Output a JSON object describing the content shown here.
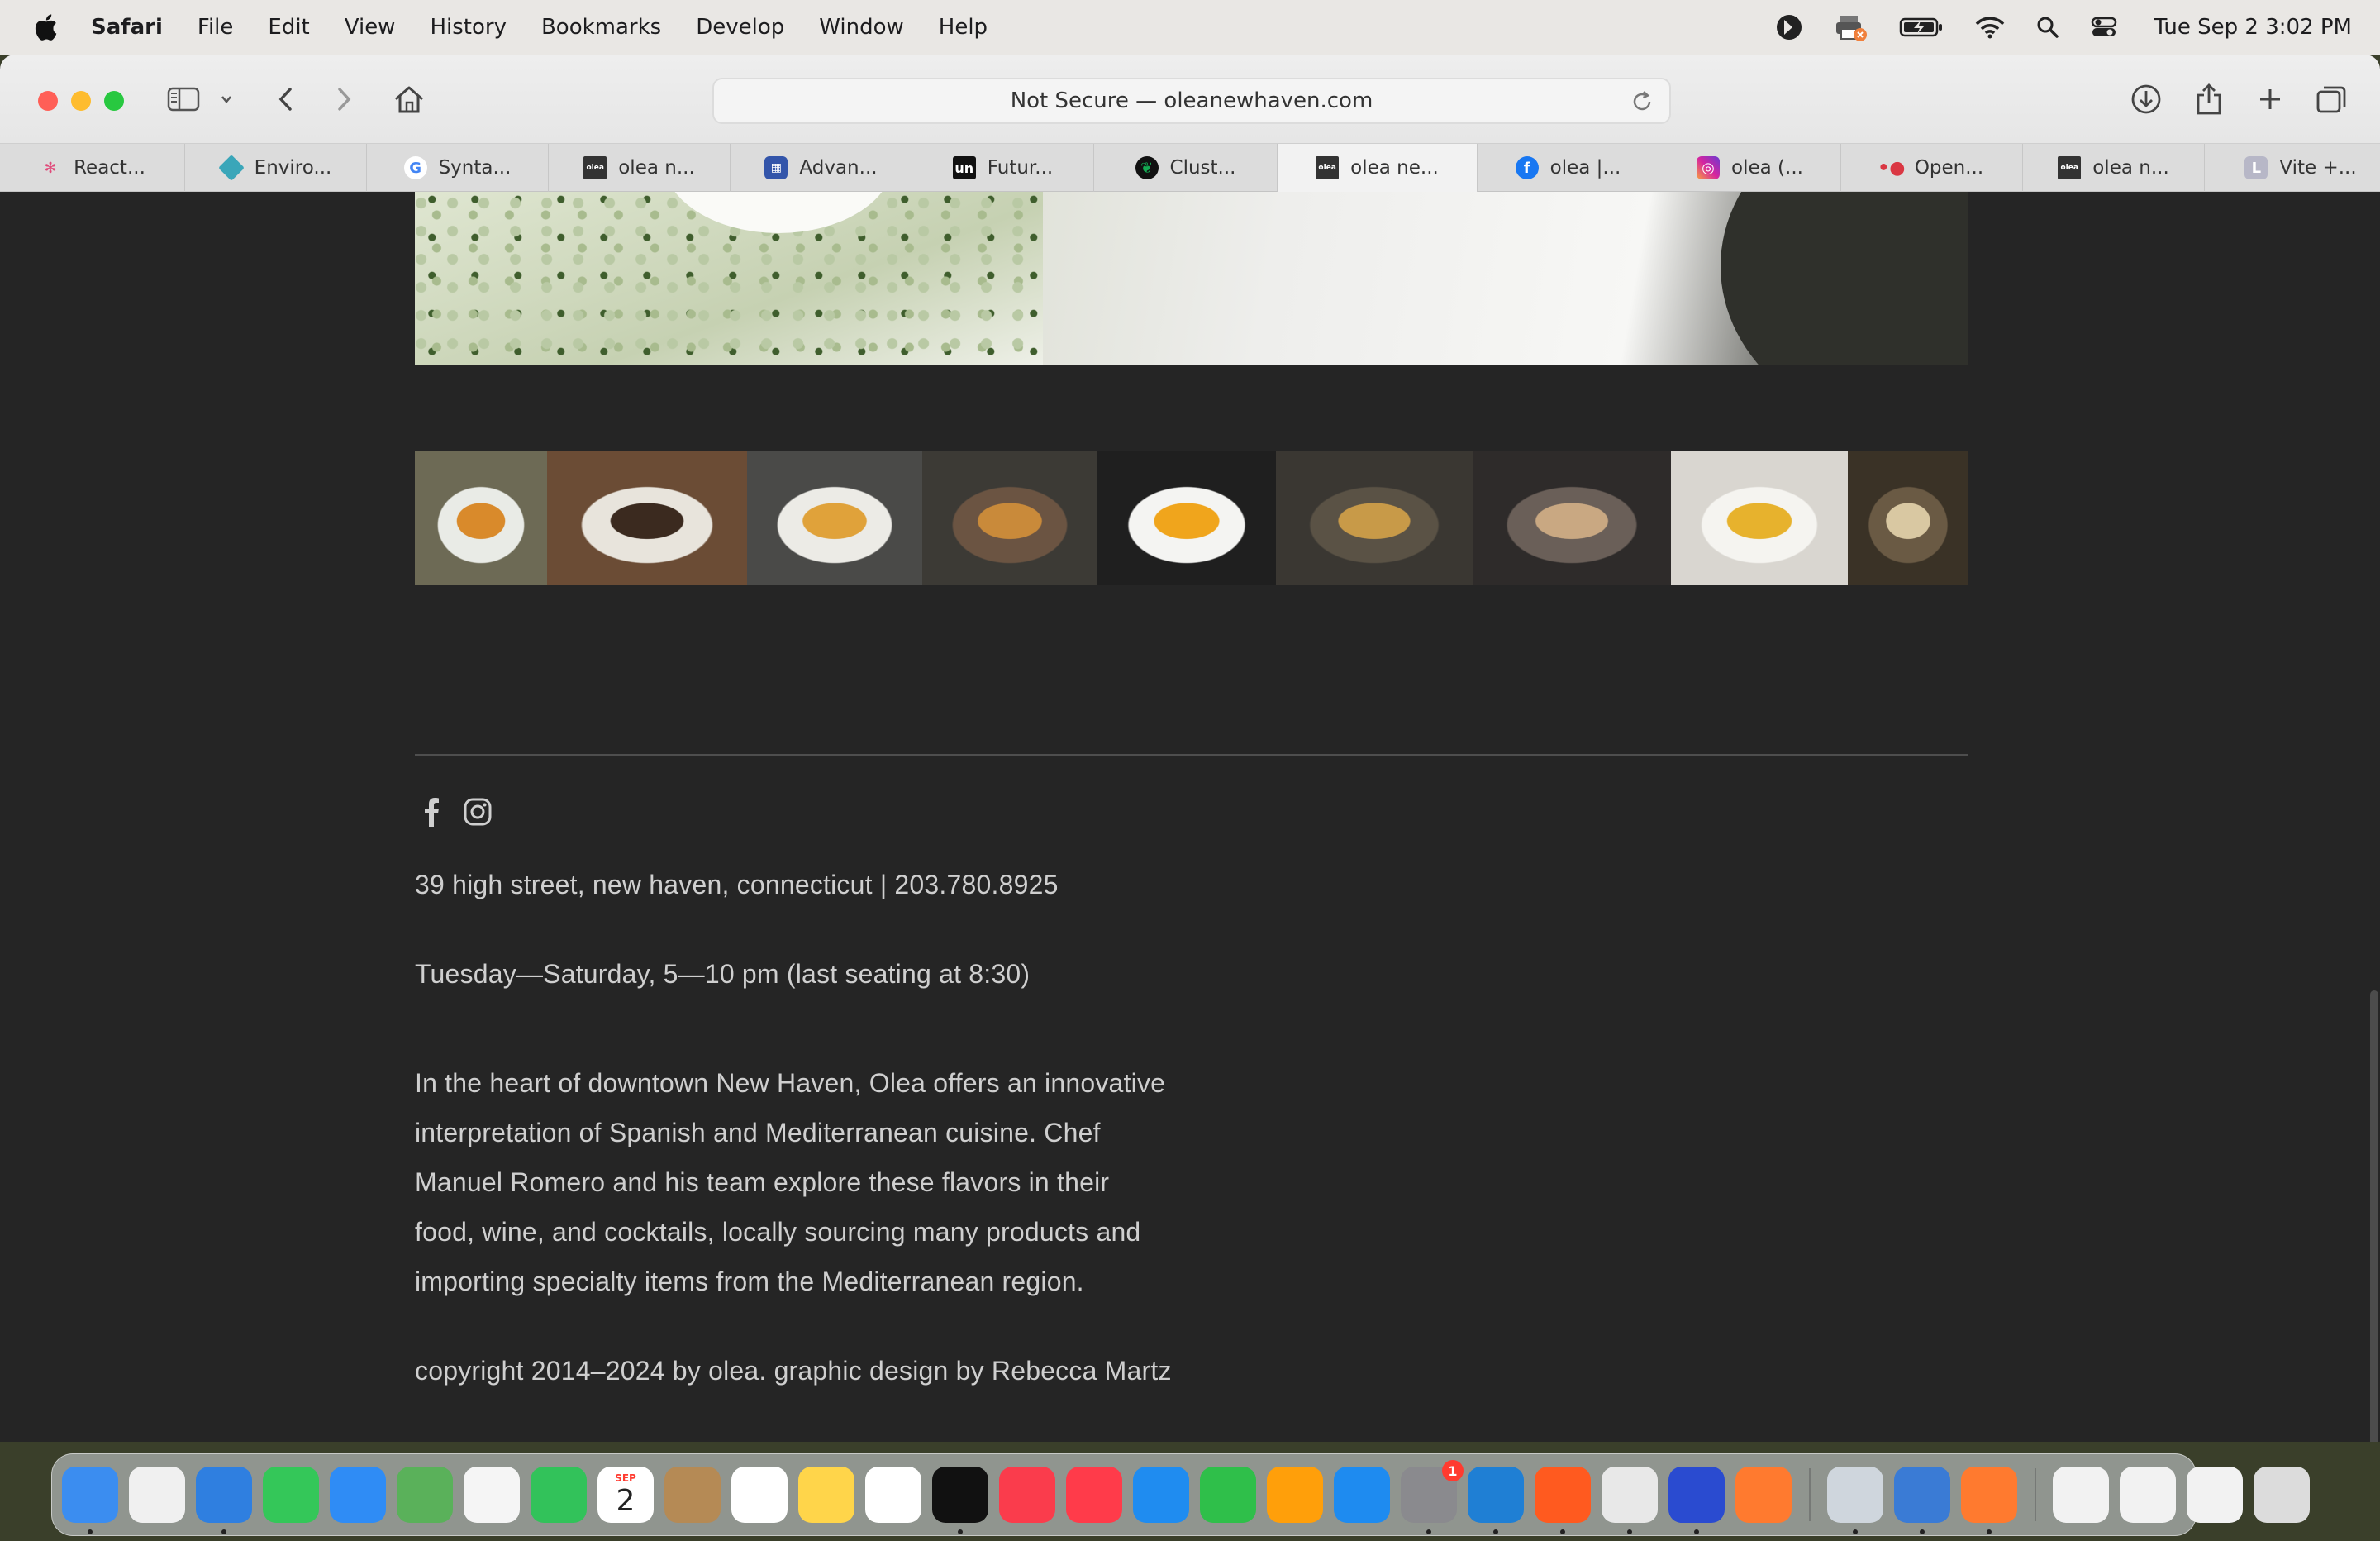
{
  "menubar": {
    "app_name": "Safari",
    "items": [
      "File",
      "Edit",
      "View",
      "History",
      "Bookmarks",
      "Develop",
      "Window",
      "Help"
    ],
    "clock": "Tue Sep 2  3:02 PM"
  },
  "browser": {
    "url_text": "Not Secure — oleanewhaven.com",
    "tabs": [
      {
        "label": "React...",
        "icon": "react-icon",
        "color": "#e04a7a"
      },
      {
        "label": "Enviro...",
        "icon": "diamond-icon",
        "color": "#3aa6b9"
      },
      {
        "label": "Synta...",
        "icon": "google-icon",
        "color": "#4285f4"
      },
      {
        "label": "olea n...",
        "icon": "olea-icon",
        "color": "#333333"
      },
      {
        "label": "Advan...",
        "icon": "bank-icon",
        "color": "#3355aa"
      },
      {
        "label": "Futur...",
        "icon": "unsplash-icon",
        "color": "#111111"
      },
      {
        "label": "Clust...",
        "icon": "mongodb-leaf-icon",
        "color": "#13aa52"
      },
      {
        "label": "olea ne...",
        "icon": "olea-icon",
        "color": "#333333",
        "active": true
      },
      {
        "label": "olea |...",
        "icon": "facebook-icon",
        "color": "#1877f2"
      },
      {
        "label": "olea (...",
        "icon": "instagram-icon",
        "color": "#d6249f"
      },
      {
        "label": "Open...",
        "icon": "opentable-icon",
        "color": "#da3743"
      },
      {
        "label": "olea n...",
        "icon": "olea-icon",
        "color": "#333333"
      },
      {
        "label": "Vite +...",
        "icon": "letter-l-icon",
        "color": "#b7b7c7"
      }
    ]
  },
  "footer": {
    "address": "39 high street, new haven, connecticut  |  203.780.8925",
    "hours": "Tuesday—Saturday, 5—10 pm (last seating at 8:30)",
    "about": "In the heart of downtown New Haven, Olea offers an innovative interpretation of Spanish and Mediterranean cuisine. Chef Manuel Romero and his team explore these flavors in their food, wine, and cocktails, locally sourcing many products and importing specialty items from the Mediterranean region.",
    "copyright": "copyright 2014–2024  by olea. graphic design by Rebecca Martz"
  },
  "gallery": {
    "thumbnails": [
      {
        "name": "dish-thumbnail-1",
        "colors": [
          "#6d6a55",
          "#e9ebe6",
          "#d98a2b"
        ]
      },
      {
        "name": "dish-thumbnail-2",
        "colors": [
          "#6b4c35",
          "#e8e4dc",
          "#3b2a1f"
        ]
      },
      {
        "name": "dish-thumbnail-3",
        "colors": [
          "#4a4a48",
          "#ecebe6",
          "#e0a23a"
        ]
      },
      {
        "name": "dish-thumbnail-4",
        "colors": [
          "#3c3a35",
          "#6b5442",
          "#c98a3a"
        ]
      },
      {
        "name": "dish-thumbnail-5",
        "colors": [
          "#1f1f1f",
          "#f4f4f2",
          "#f0a51c"
        ]
      },
      {
        "name": "dish-thumbnail-6",
        "colors": [
          "#3a3732",
          "#5a5245",
          "#c89a48"
        ]
      },
      {
        "name": "dish-thumbnail-7",
        "colors": [
          "#2e2b2a",
          "#6a5f58",
          "#c9a882"
        ]
      },
      {
        "name": "dish-thumbnail-8",
        "colors": [
          "#d9d6d0",
          "#f5f4f0",
          "#e7b22d"
        ]
      },
      {
        "name": "dining-room-thumbnail",
        "colors": [
          "#3a3226",
          "#6a5a44",
          "#d9c8a2"
        ]
      }
    ]
  },
  "dock": {
    "calendar_month": "SEP",
    "calendar_day": "2",
    "settings_badge": "1",
    "apps": [
      {
        "name": "finder-icon",
        "color": "#3b8df0"
      },
      {
        "name": "launchpad-icon",
        "color": "#f0f0f0"
      },
      {
        "name": "safari-icon",
        "color": "#2f7fe0"
      },
      {
        "name": "messages-icon",
        "color": "#34c759"
      },
      {
        "name": "mail-icon",
        "color": "#2f8cf5"
      },
      {
        "name": "maps-icon",
        "color": "#5ab15a"
      },
      {
        "name": "photos-icon",
        "color": "#f5f5f5"
      },
      {
        "name": "facetime-icon",
        "color": "#32c25a"
      },
      {
        "name": "calendar-icon",
        "color": "#ffffff"
      },
      {
        "name": "contacts-icon",
        "color": "#b58a55"
      },
      {
        "name": "reminders-icon",
        "color": "#ffffff"
      },
      {
        "name": "notes-icon",
        "color": "#ffd54a"
      },
      {
        "name": "freeform-icon",
        "color": "#ffffff"
      },
      {
        "name": "appletv-icon",
        "color": "#111111"
      },
      {
        "name": "music-icon",
        "color": "#fa3c4c"
      },
      {
        "name": "news-icon",
        "color": "#ff3b4a"
      },
      {
        "name": "keynote-icon",
        "color": "#1f8cf0"
      },
      {
        "name": "numbers-icon",
        "color": "#2fbf4a"
      },
      {
        "name": "pages-icon",
        "color": "#ff9f0a"
      },
      {
        "name": "appstore-icon",
        "color": "#1e8bf0"
      },
      {
        "name": "system-settings-icon",
        "color": "#8a8a8e"
      },
      {
        "name": "vscode-icon",
        "color": "#1f7fd4"
      },
      {
        "name": "brave-icon",
        "color": "#ff5a1f"
      },
      {
        "name": "chrome-icon",
        "color": "#e8e8e8"
      },
      {
        "name": "printer-icon",
        "color": "#2a4bd0"
      },
      {
        "name": "pen-app-icon",
        "color": "#ff7a2f"
      }
    ],
    "recent": [
      {
        "name": "preview-icon",
        "color": "#cfd6dd"
      },
      {
        "name": "network-utility-icon",
        "color": "#3a7bd5"
      },
      {
        "name": "pen-app-2-icon",
        "color": "#ff7a2f"
      }
    ],
    "stacks": [
      {
        "name": "html-file-icon",
        "color": "#f2f2f2"
      },
      {
        "name": "document-stack-icon",
        "color": "#f2f2f2"
      },
      {
        "name": "document-stack-2-icon",
        "color": "#f2f2f2"
      },
      {
        "name": "trash-icon",
        "color": "#dcdcdc"
      }
    ]
  }
}
